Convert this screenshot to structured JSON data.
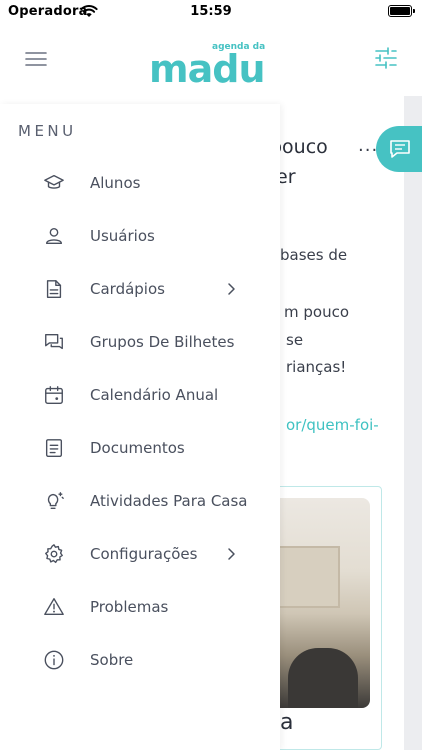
{
  "status_bar": {
    "carrier": "Operadora",
    "time": "15:59"
  },
  "header": {
    "logo_tagline": "agenda da",
    "logo_name": "madu",
    "brand_color": "#46c2c3"
  },
  "menu": {
    "heading": "MENU",
    "items": [
      {
        "label": "Alunos",
        "icon": "graduation-cap-icon",
        "has_submenu": false
      },
      {
        "label": "Usuários",
        "icon": "user-icon",
        "has_submenu": false
      },
      {
        "label": "Cardápios",
        "icon": "document-icon",
        "has_submenu": true
      },
      {
        "label": "Grupos De Bilhetes",
        "icon": "chat-bubbles-icon",
        "has_submenu": false
      },
      {
        "label": "Calendário Anual",
        "icon": "calendar-icon",
        "has_submenu": false
      },
      {
        "label": "Documentos",
        "icon": "file-list-icon",
        "has_submenu": false
      },
      {
        "label": "Atividades Para Casa",
        "icon": "lightbulb-icon",
        "has_submenu": false
      },
      {
        "label": "Configurações",
        "icon": "gear-icon",
        "has_submenu": true
      },
      {
        "label": "Problemas",
        "icon": "warning-icon",
        "has_submenu": false
      },
      {
        "label": "Sobre",
        "icon": "info-icon",
        "has_submenu": false
      }
    ]
  },
  "background": {
    "title_line1": "pouco",
    "title_line2": "er",
    "para_line1": "bases de",
    "para_line2": "m pouco",
    "para_line3": "se",
    "para_line4": "rianças!",
    "link_fragment": "or/quem-foi-",
    "caption_fragment": "a"
  }
}
